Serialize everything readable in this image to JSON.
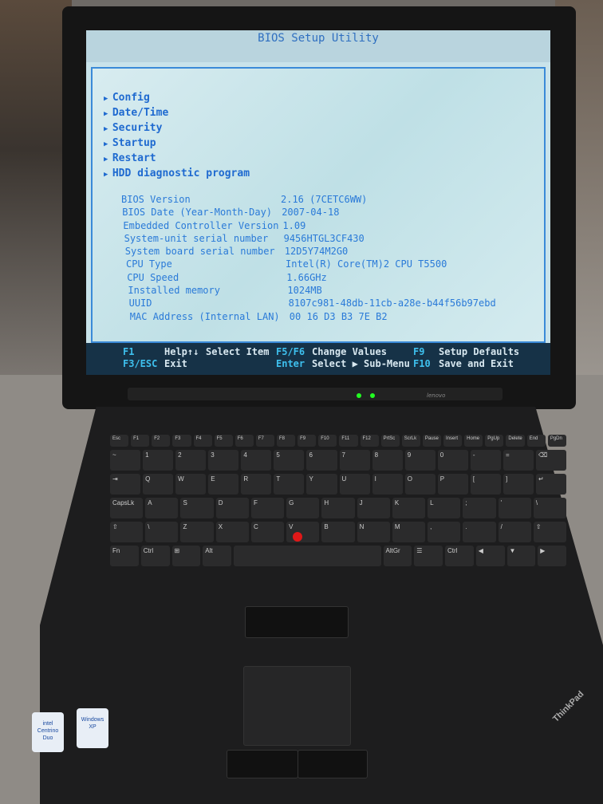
{
  "bios": {
    "title": "BIOS Setup Utility",
    "menu": [
      "Config",
      "Date/Time",
      "Security",
      "Startup",
      "Restart",
      "HDD diagnostic program"
    ],
    "info": [
      {
        "label": "BIOS Version",
        "value": "2.16  (7CETC6WW)"
      },
      {
        "label": "BIOS Date (Year-Month-Day)",
        "value": "2007-04-18"
      },
      {
        "label": "Embedded Controller Version",
        "value": "1.09"
      },
      {
        "label": "System-unit serial number",
        "value": "9456HTGL3CF430"
      },
      {
        "label": "System board serial number",
        "value": "12D5Y74M2G0"
      },
      {
        "label": "CPU Type",
        "value": "Intel(R) Core(TM)2 CPU         T5500"
      },
      {
        "label": "CPU Speed",
        "value": "1.66GHz"
      },
      {
        "label": "Installed memory",
        "value": "1024MB"
      },
      {
        "label": "UUID",
        "value": "8107c981-48db-11cb-a28e-b44f56b97ebd"
      },
      {
        "label": "MAC Address (Internal LAN)",
        "value": "00 16 D3 B3 7E B2"
      }
    ],
    "footer": {
      "f1": "F1",
      "help": "Help↑↓",
      "select_item": "Select Item",
      "f5f6": "F5/F6",
      "change_values": "Change Values",
      "f9": "F9",
      "setup_defaults": "Setup Defaults",
      "f3esc": "F3/ESC",
      "exit": "Exit",
      "enter": "Enter",
      "select_submenu": "Select ▶ Sub-Menu",
      "f10": "F10",
      "save_exit": "Save and Exit"
    }
  },
  "laptop": {
    "brand": "lenovo",
    "logo": "ThinkPad",
    "stickers": [
      "intel Centrino Duo",
      "Windows XP"
    ]
  },
  "keyboard": {
    "rows": [
      [
        "Esc",
        "F1",
        "F2",
        "F3",
        "F4",
        "F5",
        "F6",
        "F7",
        "F8",
        "F9",
        "F10",
        "F11",
        "F12",
        "PrtSc",
        "ScrLk",
        "Pause",
        "Insert",
        "Home",
        "PgUp",
        "Delete",
        "End",
        "PgDn"
      ],
      [
        "~",
        "1",
        "2",
        "3",
        "4",
        "5",
        "6",
        "7",
        "8",
        "9",
        "0",
        "-",
        "=",
        "⌫"
      ],
      [
        "⇥",
        "Q",
        "W",
        "E",
        "R",
        "T",
        "Y",
        "U",
        "I",
        "O",
        "P",
        "[",
        "]",
        "↵"
      ],
      [
        "CapsLk",
        "A",
        "S",
        "D",
        "F",
        "G",
        "H",
        "J",
        "K",
        "L",
        ";",
        "'",
        "\\"
      ],
      [
        "⇧",
        "\\",
        "Z",
        "X",
        "C",
        "V",
        "B",
        "N",
        "M",
        ",",
        ".",
        "/",
        "⇧"
      ],
      [
        "Fn",
        "Ctrl",
        "⊞",
        "Alt",
        "",
        "AltGr",
        "☰",
        "Ctrl",
        "◀",
        "▼",
        "▶"
      ]
    ]
  }
}
